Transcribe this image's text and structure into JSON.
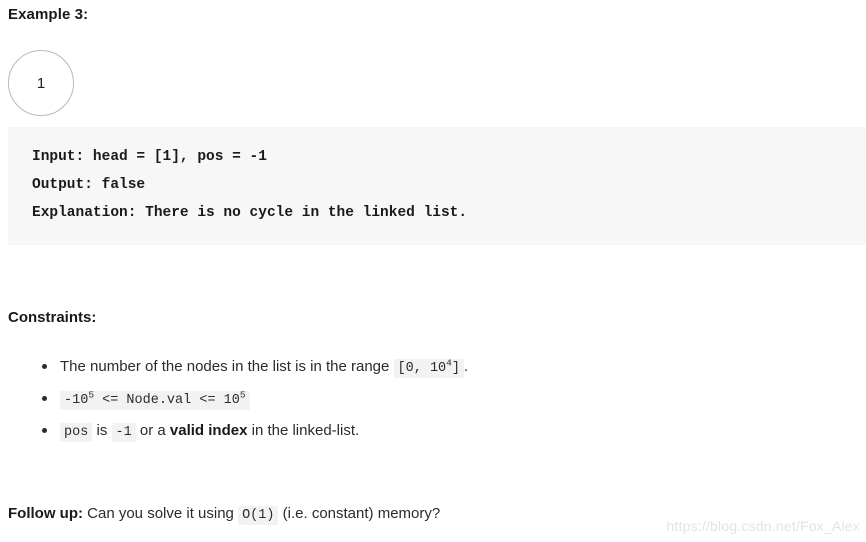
{
  "example": {
    "title": "Example 3:",
    "node_value": "1",
    "code_lines": [
      "Input: head = [1], pos = -1",
      "Output: false",
      "Explanation: There is no cycle in the linked list."
    ]
  },
  "constraints": {
    "title": "Constraints:",
    "items": [
      {
        "before": "The number of the nodes in the list is in the range",
        "chip": "[0, 10",
        "chip_sup": "4",
        "chip_tail": "]",
        "after": "."
      },
      {
        "chip_lead": "-10",
        "chip_lead_sup": "5",
        "chip_mid": "<= Node.val <= 10",
        "chip_mid_sup": "5"
      },
      {
        "chip": "pos",
        "mid1": "is",
        "chip2": "-1",
        "mid2": "or a",
        "bold": "valid index",
        "tail": "in the linked-list."
      }
    ]
  },
  "follow_up": {
    "label": "Follow up:",
    "text_before": "Can you solve it using",
    "chip": "O(1)",
    "text_after": "(i.e. constant) memory?"
  },
  "watermark": "https://blog.csdn.net/Fox_Alex"
}
